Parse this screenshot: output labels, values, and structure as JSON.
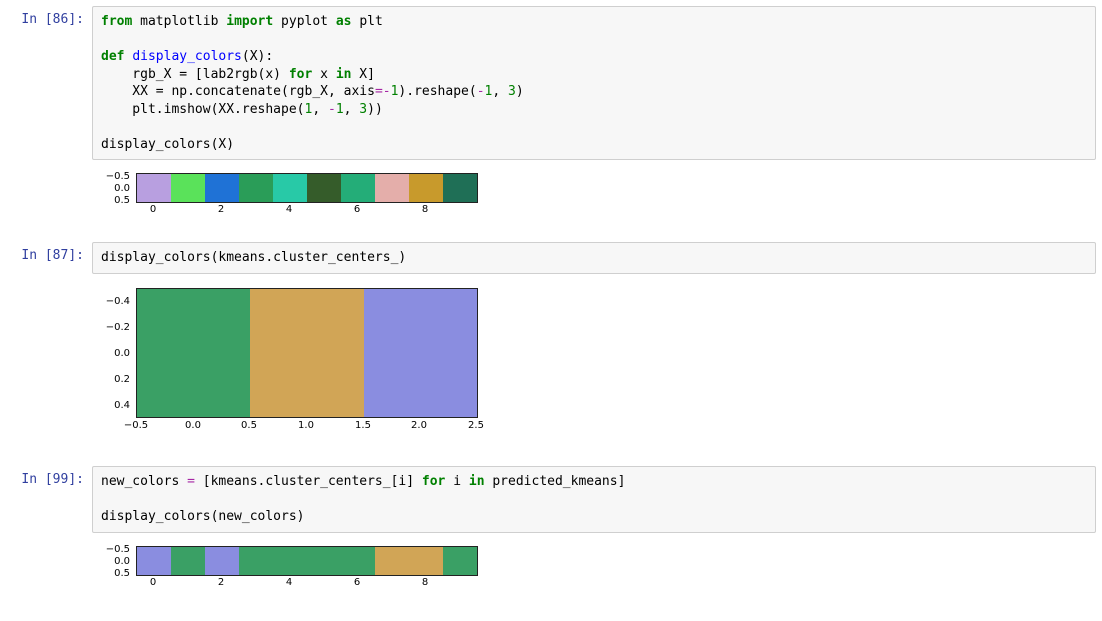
{
  "cells": {
    "c86": {
      "prompt": "In [86]:",
      "line1_from": "from",
      "line1_mod": "matplotlib",
      "line1_import": "import",
      "line1_alias": "pyplot",
      "line1_as": "as",
      "line1_plt": "plt",
      "line3_def": "def",
      "line3_fn": "display_colors",
      "line3_rest": "(X):",
      "line4": "    rgb_X = [lab2rgb(x) ",
      "line4_for": "for",
      "line4_mid": " x ",
      "line4_in": "in",
      "line4_end": " X]",
      "line5a": "    XX = np.concatenate(rgb_X, axis",
      "line5_eq": "=",
      "line5_neg": "-",
      "line5_one": "1",
      "line5b": ").reshape(",
      "line5_neg2": "-",
      "line5_one2": "1",
      "line5c": ", ",
      "line5_three": "3",
      "line5d": ")",
      "line6a": "    plt.imshow(XX.reshape(",
      "line6_1": "1",
      "line6b": ", ",
      "line6_neg": "-",
      "line6_1b": "1",
      "line6c": ", ",
      "line6_3": "3",
      "line6d": "))",
      "line8": "display_colors(X)"
    },
    "c87": {
      "prompt": "In [87]:",
      "line": "display_colors(kmeans.cluster_centers_)"
    },
    "c99": {
      "prompt": "In [99]:",
      "line1a": "new_colors ",
      "line1_eq": "=",
      "line1b": " [kmeans.cluster_centers_[i] ",
      "line1_for": "for",
      "line1c": " i ",
      "line1_in": "in",
      "line1d": " predicted_kmeans]",
      "line3": "display_colors(new_colors)"
    }
  },
  "chart_data": [
    {
      "type": "heatmap",
      "cell": "86",
      "yticks": [
        "−0.5",
        "0.0",
        "0.5"
      ],
      "xticks": [
        "0",
        "2",
        "4",
        "6",
        "8"
      ],
      "colors": [
        "#b89fe0",
        "#5ae25a",
        "#1f72d6",
        "#2a9d58",
        "#28c9a7",
        "#355c2a",
        "#24ad78",
        "#e4aeaa",
        "#c89a2c",
        "#1f6f56"
      ]
    },
    {
      "type": "heatmap",
      "cell": "87",
      "yticks": [
        "−0.4",
        "−0.2",
        "0.0",
        "0.2",
        "0.4"
      ],
      "xticks": [
        "−0.5",
        "0.0",
        "0.5",
        "1.0",
        "1.5",
        "2.0",
        "2.5"
      ],
      "colors": [
        "#3aa065",
        "#d1a556",
        "#8a8de0"
      ]
    },
    {
      "type": "heatmap",
      "cell": "99",
      "yticks": [
        "−0.5",
        "0.0",
        "0.5"
      ],
      "xticks": [
        "0",
        "2",
        "4",
        "6",
        "8"
      ],
      "colors": [
        "#8a8de0",
        "#3aa065",
        "#8a8de0",
        "#3aa065",
        "#3aa065",
        "#3aa065",
        "#3aa065",
        "#d1a556",
        "#d1a556",
        "#3aa065"
      ]
    }
  ]
}
